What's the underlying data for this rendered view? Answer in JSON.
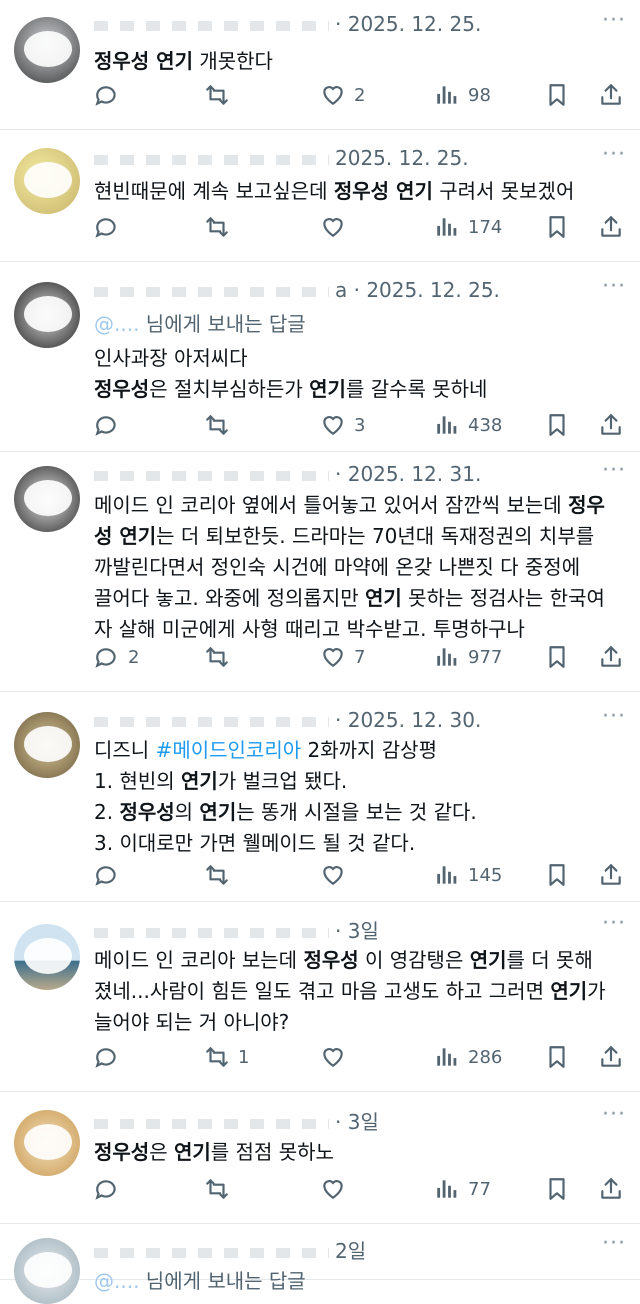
{
  "colors": {
    "text": "#0f1419",
    "secondary": "#536471",
    "link": "#1d9bf0",
    "divider": "#e6e9ec"
  },
  "icons": [
    "reply-icon",
    "retweet-icon",
    "heart-icon",
    "views-icon",
    "bookmark-icon",
    "share-icon",
    "more-icon"
  ],
  "tweets": [
    {
      "date": "· 2025. 12. 25.",
      "more": "···",
      "lines": [
        [
          {
            "t": "정우성 연기",
            "b": true
          },
          {
            "t": " 개못한다"
          }
        ]
      ],
      "reply_count": "",
      "retweet_count": "",
      "like_count": "2",
      "view_count": "98"
    },
    {
      "date": "2025. 12. 25.",
      "more": "···",
      "lines": [
        [
          {
            "t": "현빈때문에 계속 보고싶은데 "
          },
          {
            "t": "정우성 연기",
            "b": true
          },
          {
            "t": " 구려서 못보겠어"
          }
        ]
      ],
      "reply_count": "",
      "retweet_count": "",
      "like_count": "",
      "view_count": "174"
    },
    {
      "date": "a · 2025. 12. 25.",
      "more": "···",
      "reply_to": {
        "handle": "@....",
        "suffix": " 님에게 보내는 답글"
      },
      "lines": [
        [
          {
            "t": "인사과장 아저씨다"
          }
        ],
        [
          {
            "t": "정우성",
            "b": true
          },
          {
            "t": "은 절치부심하든가 "
          },
          {
            "t": "연기",
            "b": true
          },
          {
            "t": "를 갈수록 못하네"
          }
        ]
      ],
      "reply_count": "",
      "retweet_count": "",
      "like_count": "3",
      "view_count": "438"
    },
    {
      "date": "· 2025. 12. 31.",
      "more": "···",
      "lines": [
        [
          {
            "t": "메이드 인 코리아 옆에서 틀어놓고 있어서 잠깐씩 보는데 "
          },
          {
            "t": "정우",
            "b": true
          }
        ],
        [
          {
            "t": "성 연기",
            "b": true
          },
          {
            "t": "는 더 퇴보한듯. 드라마는 70년대 독재정권의 치부를"
          }
        ],
        [
          {
            "t": "까발린다면서 정인숙 시건에 마약에  온갖 나쁜짓 다 중정에"
          }
        ],
        [
          {
            "t": "끌어다 놓고. 와중에 정의롭지만 "
          },
          {
            "t": "연기",
            "b": true
          },
          {
            "t": " 못하는 정검사는 한국여"
          }
        ],
        [
          {
            "t": "자 살해 미군에게 사형 때리고 박수받고. 투명하구나"
          }
        ]
      ],
      "reply_count": "2",
      "retweet_count": "",
      "like_count": "7",
      "view_count": "977"
    },
    {
      "date": "· 2025. 12. 30.",
      "more": "···",
      "lines": [
        [
          {
            "t": "디즈니 "
          },
          {
            "t": "#메이드인코리아",
            "tag": true
          },
          {
            "t": " 2화까지 감상평"
          }
        ],
        [
          {
            "t": "1. 현빈의 "
          },
          {
            "t": "연기",
            "b": true
          },
          {
            "t": "가 벌크업 됐다."
          }
        ],
        [
          {
            "t": "2. "
          },
          {
            "t": "정우성",
            "b": true
          },
          {
            "t": "의 "
          },
          {
            "t": "연기",
            "b": true
          },
          {
            "t": "는 똥개 시절을 보는 것 같다."
          }
        ],
        [
          {
            "t": "3. 이대로만 가면 웰메이드 될 것 같다."
          }
        ]
      ],
      "reply_count": "",
      "retweet_count": "",
      "like_count": "",
      "view_count": "145"
    },
    {
      "date": "· 3일",
      "more": "···",
      "lines": [
        [
          {
            "t": "메이드 인 코리아 보는데 "
          },
          {
            "t": "정우성",
            "b": true
          },
          {
            "t": " 이 영감탱은 "
          },
          {
            "t": "연기",
            "b": true
          },
          {
            "t": "를 더 못해"
          }
        ],
        [
          {
            "t": "졌네...사람이 힘든 일도 겪고 마음 고생도 하고 그러면 "
          },
          {
            "t": "연기",
            "b": true
          },
          {
            "t": "가"
          }
        ],
        [
          {
            "t": "늘어야 되는 거 아니야?"
          }
        ]
      ],
      "reply_count": "",
      "retweet_count": "1",
      "like_count": "",
      "view_count": "286"
    },
    {
      "date": "· 3일",
      "more": "···",
      "lines": [
        [
          {
            "t": "정우성",
            "b": true
          },
          {
            "t": "은 "
          },
          {
            "t": "연기",
            "b": true
          },
          {
            "t": "를 점점 못하노"
          }
        ]
      ],
      "reply_count": "",
      "retweet_count": "",
      "like_count": "",
      "view_count": "77"
    },
    {
      "date": "2일",
      "more": "···",
      "reply_to": {
        "handle": "@....",
        "suffix": " 님에게 보내는 답글"
      },
      "lines": [],
      "reply_count": "",
      "retweet_count": "",
      "like_count": "",
      "view_count": ""
    }
  ]
}
